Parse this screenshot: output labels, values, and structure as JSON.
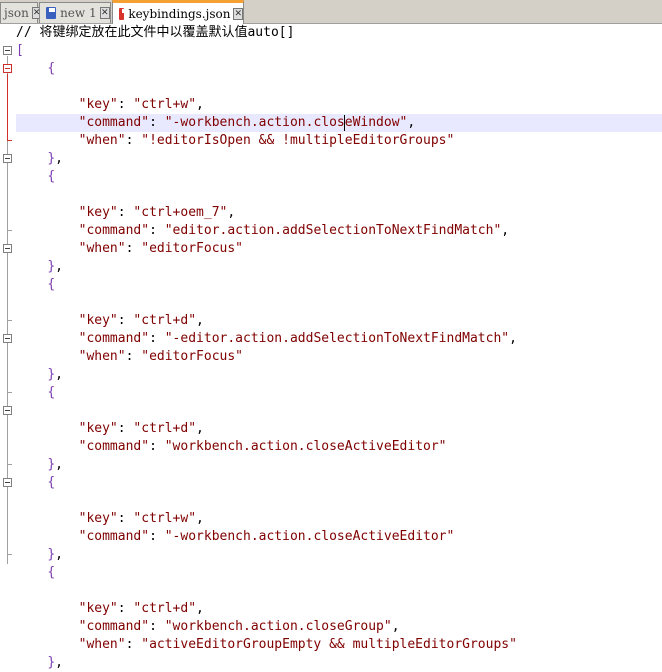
{
  "tabs": [
    {
      "label": "json",
      "icon": "disk-blue",
      "active": false
    },
    {
      "label": "new 1",
      "icon": "disk-blue",
      "active": false
    },
    {
      "label": "keybindings.json",
      "icon": "disk-red",
      "active": true
    }
  ],
  "editor": {
    "comment": "// 将键绑定放在此文件中以覆盖默认值auto[]",
    "open_bracket": "[",
    "entries": [
      {
        "key": "ctrl+w",
        "command": "-workbench.action.closeWindow",
        "when": "!editorIsOpen && !multipleEditorGroups"
      },
      {
        "key": "ctrl+oem_7",
        "command": "editor.action.addSelectionToNextFindMatch",
        "when": "editorFocus"
      },
      {
        "key": "ctrl+d",
        "command": "-editor.action.addSelectionToNextFindMatch",
        "when": "editorFocus"
      },
      {
        "key": "ctrl+d",
        "command": "workbench.action.closeActiveEditor",
        "when": null
      },
      {
        "key": "ctrl+w",
        "command": "-workbench.action.closeActiveEditor",
        "when": null
      },
      {
        "key": "ctrl+d",
        "command": "workbench.action.closeGroup",
        "when": "activeEditorGroupEmpty && multipleEditorGroups"
      }
    ]
  },
  "colors": {
    "brace": "#7a3cb3",
    "string": "#800000",
    "fold_active": "#d0302a",
    "current_line": "#e8e8ff",
    "active_tab_accent": "#f5a033"
  }
}
